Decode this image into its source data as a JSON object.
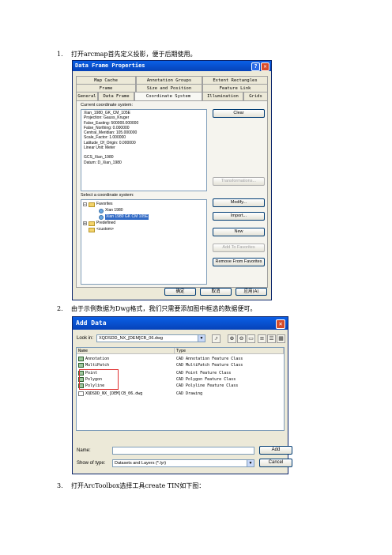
{
  "steps": [
    {
      "num": "1.",
      "text": "打开arcmap首先定义投影，便于后期使用。"
    },
    {
      "num": "2.",
      "text": "由于示例数据为Dwg格式，我们只需要添加图中框选的数据便可。"
    },
    {
      "num": "3.",
      "text": "打开ArcToolbox选择工具create TIN如下图："
    }
  ],
  "dialog1": {
    "title": "Data Frame Properties",
    "help_glyph": "?",
    "close_glyph": "✕",
    "tabs_row1": [
      "Map Cache",
      "Annotation Groups",
      "Extent Rectangles"
    ],
    "tabs_row2": [
      "Frame",
      "Size and Position",
      "Feature Link"
    ],
    "tabs_row3": [
      "General",
      "Data Frame",
      "Coordinate System",
      "Illumination",
      "Grids"
    ],
    "current_label": "Current coordinate system:",
    "coord_text": [
      "Xian_1980_GK_CM_105E",
      "Projection: Gauss_Kruger",
      "False_Easting: 500000.000000",
      "False_Northing: 0.000000",
      "Central_Meridian: 105.000000",
      "Scale_Factor: 1.000000",
      "Latitude_Of_Origin: 0.000000",
      "Linear Unit: Meter",
      "",
      "GCS_Xian_1980",
      "Datum: D_Xian_1980"
    ],
    "buttons": {
      "clear": "Clear",
      "transformations": "Transformations...",
      "modify": "Modify...",
      "import": "Import...",
      "new": "New",
      "add_favorites": "Add To Favorites",
      "remove_favorites": "Remove From Favorites"
    },
    "select_label": "Select a coordinate system:",
    "tree": {
      "favorites": "Favorites",
      "item1": "Xian 1980",
      "item2": "Xian 1980 GK CM 105E",
      "predefined": "Predefined",
      "custom": "<custom>"
    },
    "footer": {
      "ok": "确定",
      "cancel": "取消",
      "apply": "应用(A)"
    }
  },
  "dialog2": {
    "title": "Add Data",
    "close_glyph": "✕",
    "lookin_label": "Look in:",
    "lookin_value": "XQDSDD_NX_[DEM]CB_06.dwg",
    "col_name": "Name",
    "col_type": "Type",
    "rows": [
      {
        "name": "Annotation",
        "type": "CAD Annotation Feature Class"
      },
      {
        "name": "MultiPatch",
        "type": "CAD MultiPatch Feature Class"
      },
      {
        "name": "Point",
        "type": "CAD Point Feature Class"
      },
      {
        "name": "Polygon",
        "type": "CAD Polygon Feature Class"
      },
      {
        "name": "Polyline",
        "type": "CAD Polyline Feature Class"
      },
      {
        "name": "XQDSDD_NX_[DEM]CB_06.dwg",
        "type": "CAD Drawing"
      }
    ],
    "name_label": "Name:",
    "show_label": "Show of type:",
    "show_value": "Datasets and Layers (*.lyr)",
    "add": "Add",
    "cancel": "Cancel",
    "highlight_color": "#e03030"
  }
}
